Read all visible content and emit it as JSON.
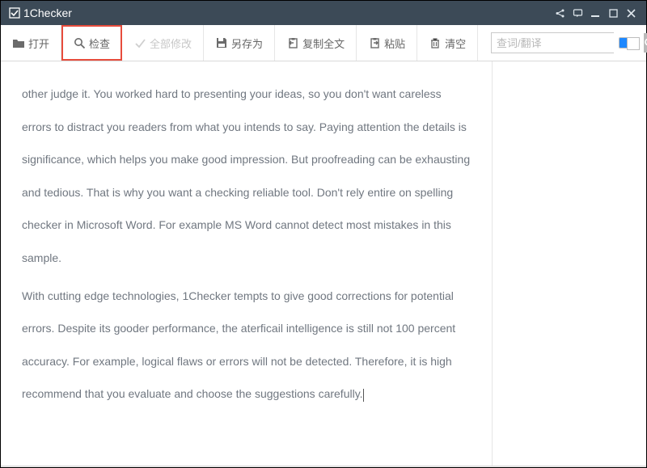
{
  "app": {
    "title": "1Checker"
  },
  "toolbar": {
    "open": "打开",
    "check": "检查",
    "fixall": "全部修改",
    "saveas": "另存为",
    "copyall": "复制全文",
    "paste": "粘贴",
    "clear": "清空"
  },
  "search": {
    "placeholder": "查词/翻译"
  },
  "document": {
    "para1": "other judge it. You worked hard to presenting your ideas, so you don't want careless errors to distract you readers from what you intends to say. Paying attention the details is significance, which helps you make good impression. But proofreading can be exhausting and tedious. That is why you want a checking reliable tool. Don't rely entire on spelling checker in Microsoft Word. For example MS Word cannot detect most mistakes in this sample.",
    "para2": "With cutting edge technologies, 1Checker tempts to give good corrections for potential errors. Despite its gooder performance, the aterficail intelligence is still not 100 percent accuracy. For example, logical flaws or errors will not be detected. Therefore, it is high recommend that you evaluate and choose the suggestions carefully."
  }
}
